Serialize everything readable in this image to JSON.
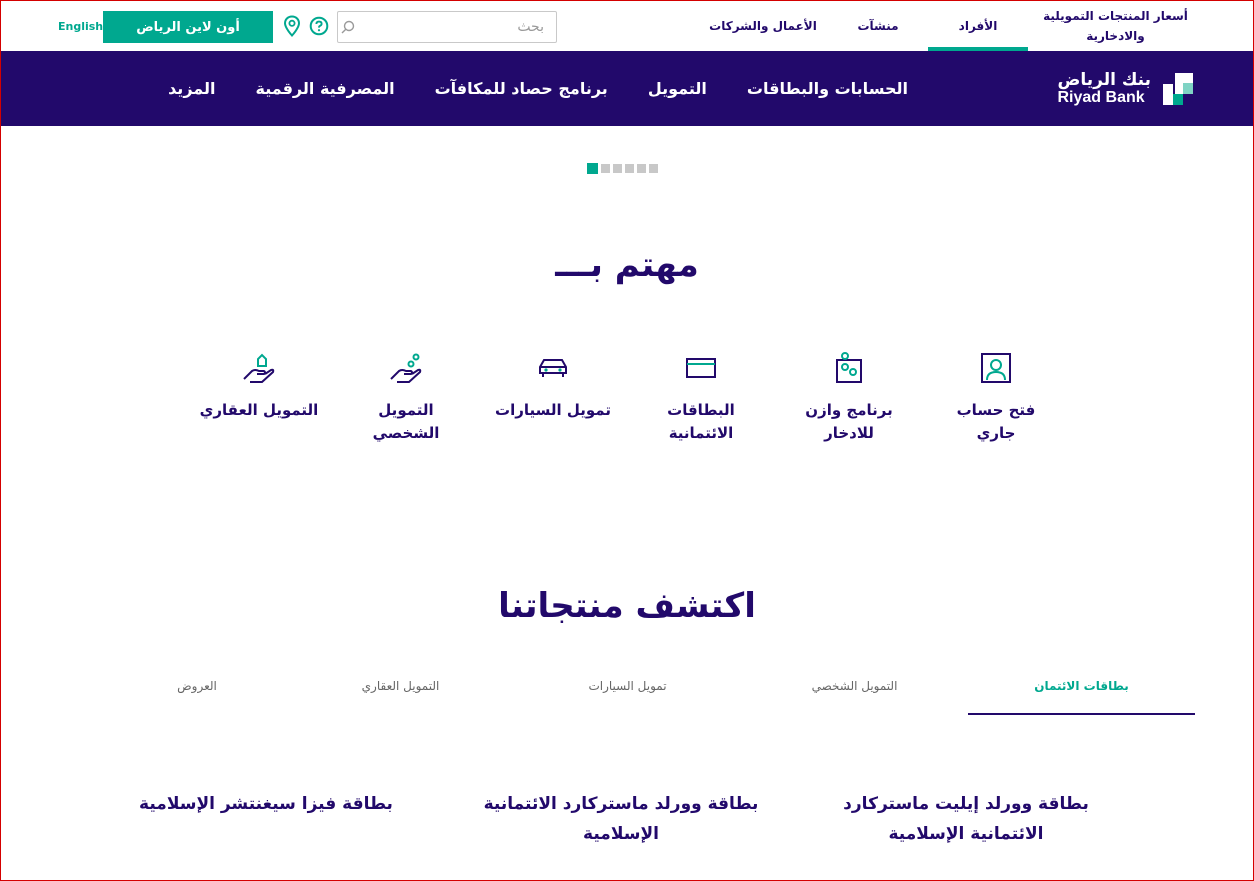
{
  "topbar": {
    "segments": [
      {
        "label": "أسعار المنتجات التمويلية والادخارية",
        "active": false
      },
      {
        "label": "الأفراد",
        "active": true
      },
      {
        "label": "منشآت",
        "active": false
      },
      {
        "label": "الأعمال والشركات",
        "active": false
      }
    ],
    "search_placeholder": "بحث",
    "online_button": "أون لاين الرياض",
    "language_link": "English"
  },
  "brand": {
    "name_ar": "بنك الرياض",
    "name_en": "Riyad Bank"
  },
  "nav": {
    "items": [
      "الحسابات والبطاقات",
      "التمويل",
      "برنامج حصاد للمكافآت",
      "المصرفية الرقمية",
      "المزيد"
    ]
  },
  "slider": {
    "count": 6,
    "active": 0
  },
  "interested": {
    "title": "مهتم بـــ",
    "links": [
      {
        "label": "فتح حساب جاري",
        "icon": "user-icon"
      },
      {
        "label": "برنامج وازن للادخار",
        "icon": "coins-icon"
      },
      {
        "label": "البطاقات الائتمانية",
        "icon": "card-icon"
      },
      {
        "label": "تمويل السيارات",
        "icon": "car-icon"
      },
      {
        "label": "التمويل الشخصي",
        "icon": "hand-coins-icon"
      },
      {
        "label": "التمويل العقاري",
        "icon": "hand-house-icon"
      }
    ]
  },
  "explore": {
    "title": "اكتشف منتجاتنا",
    "tabs": [
      "بطاقات الائتمان",
      "التمويل الشخصي",
      "تمويل السيارات",
      "التمويل العقاري",
      "العروض"
    ],
    "active_tab": 0,
    "cards": [
      "بطاقة وورلد إيليت ماستركارد الائتمانية الإسلامية",
      "بطاقة وورلد ماستركارد الائتمانية الإسلامية",
      "بطاقة فيزا سيغنتشر الإسلامية"
    ]
  },
  "colors": {
    "primary": "#22096b",
    "accent": "#00a88f"
  }
}
